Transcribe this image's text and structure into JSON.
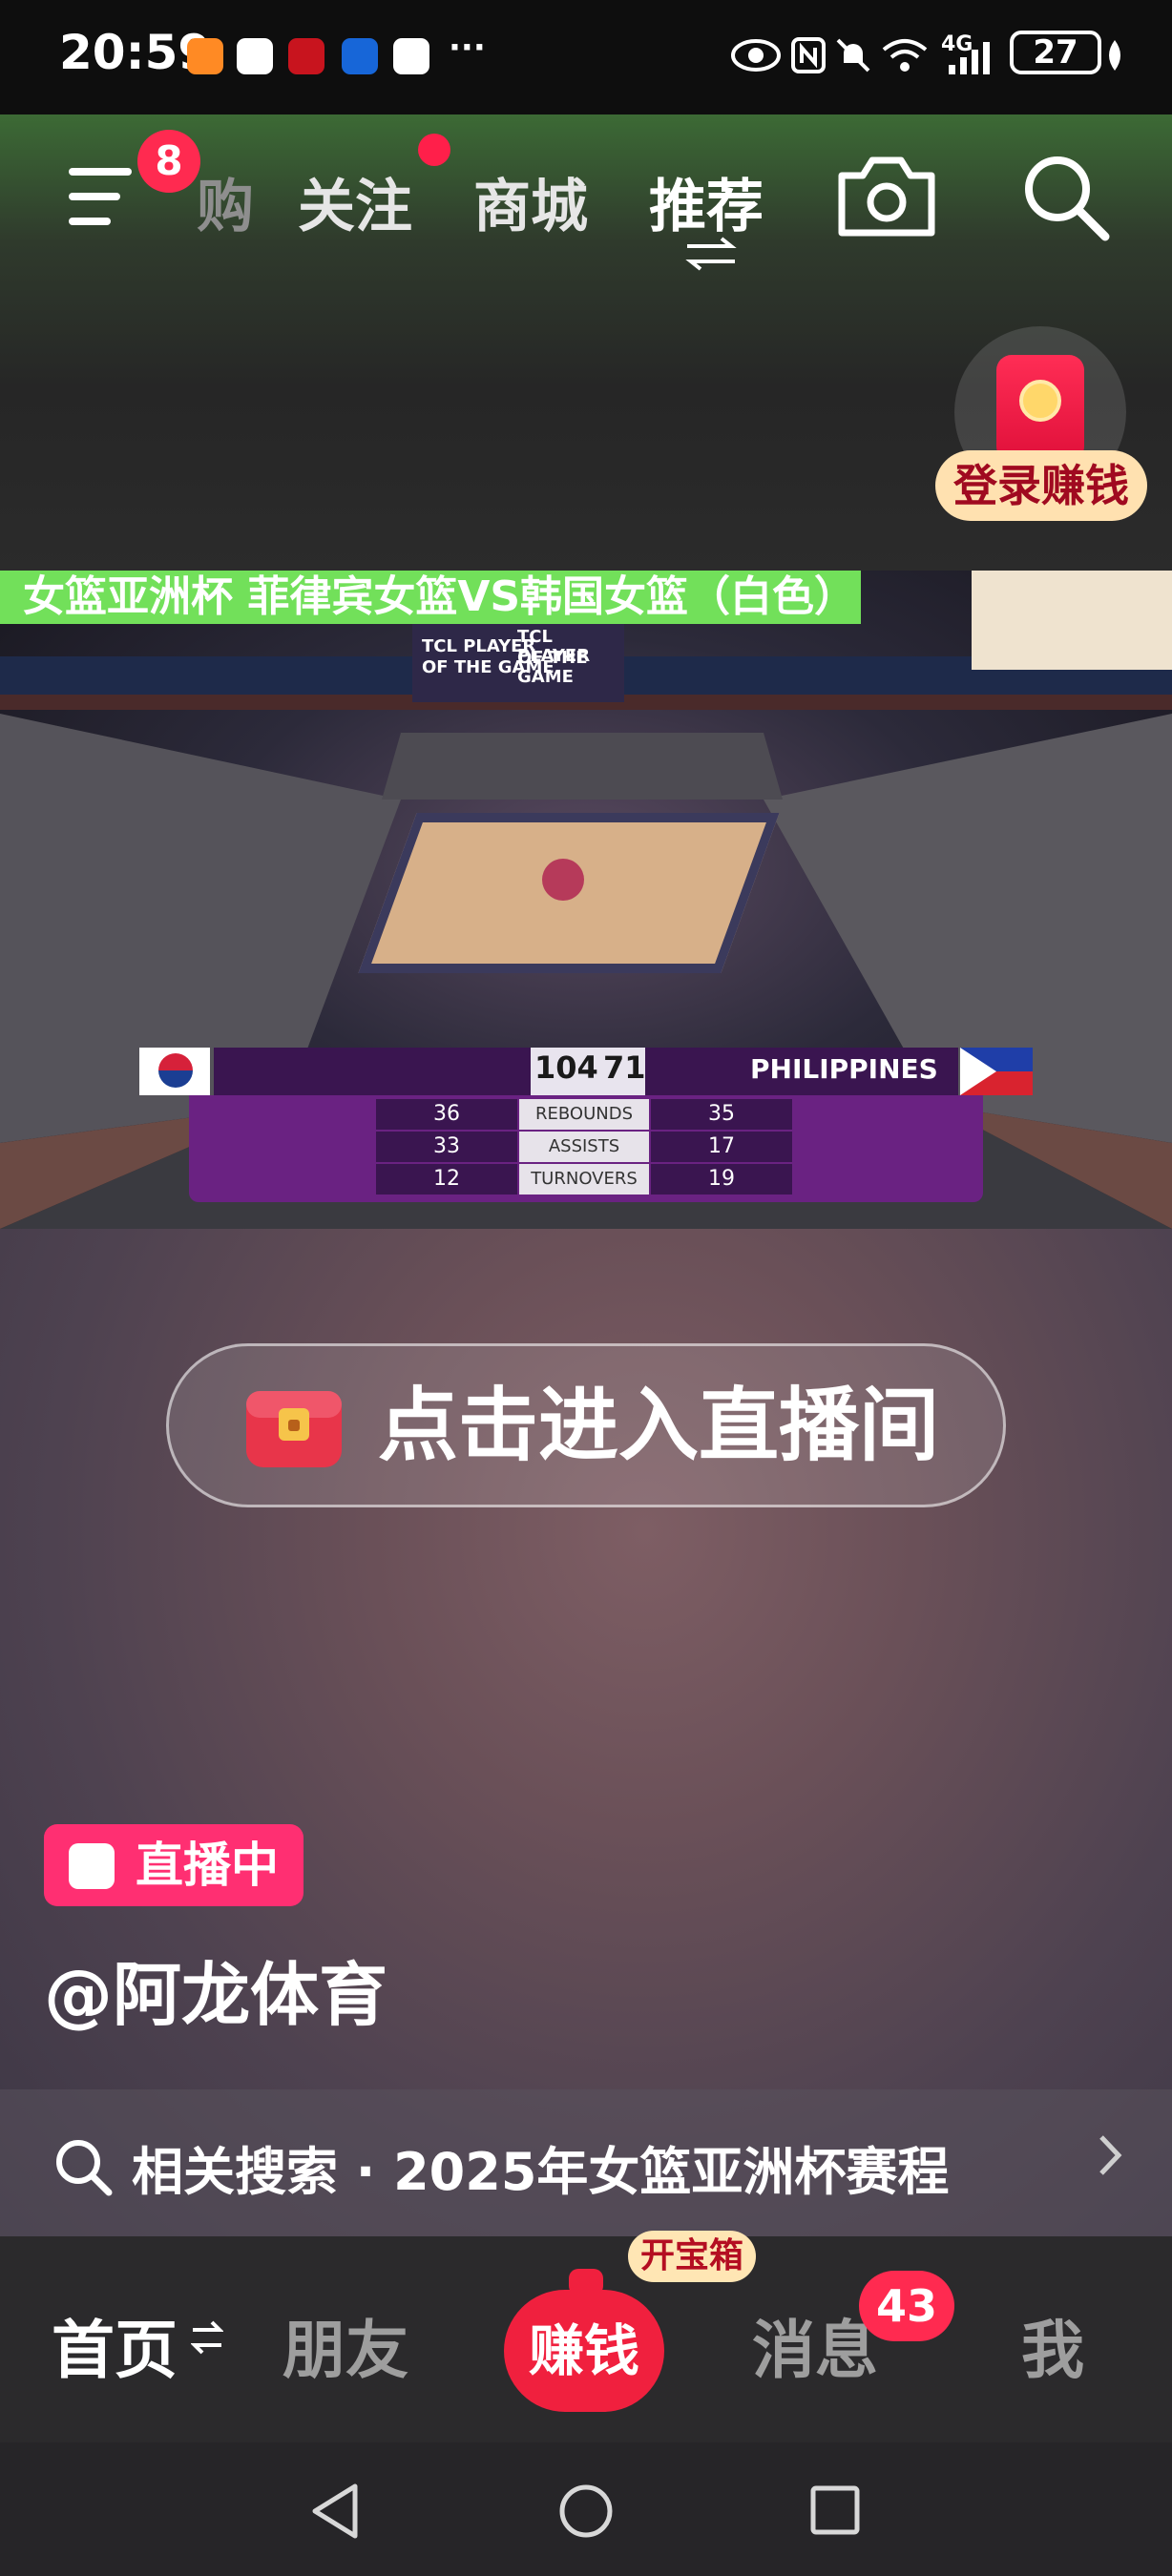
{
  "status_bar": {
    "time": "20:59",
    "more": "···",
    "network": "4G",
    "battery": "27"
  },
  "top_nav": {
    "tabs": [
      {
        "label": "购",
        "active": false
      },
      {
        "label": "关注",
        "active": false
      },
      {
        "label": "商城",
        "active": false
      },
      {
        "label": "推荐",
        "active": true
      }
    ],
    "menu_badge": "8",
    "icons": [
      "menu-icon",
      "camera-icon",
      "search-icon"
    ]
  },
  "red_packet": {
    "label": "登录赚钱"
  },
  "video": {
    "title": "女篮亚洲杯  菲律宾女篮VS韩国女篮（白色）",
    "sponsor_logo": "阿龙体育",
    "banner_text": [
      "TCL PLAYER",
      "OF THE GAME"
    ],
    "scoreboard": {
      "score_left": "104",
      "score_right": "71",
      "team_right": "PHILIPPINES",
      "stats": [
        {
          "left": "36",
          "label": "REBOUNDS",
          "right": "35"
        },
        {
          "left": "33",
          "label": "ASSISTS",
          "right": "17"
        },
        {
          "left": "12",
          "label": "TURNOVERS",
          "right": "19"
        }
      ]
    }
  },
  "enter_live": {
    "label": "点击进入直播间"
  },
  "live_badge": {
    "label": "直播中"
  },
  "streamer": {
    "name": "@阿龙体育"
  },
  "related_search": {
    "text": "相关搜索 · 2025年女篮亚洲杯赛程"
  },
  "bottom_nav": {
    "tabs": [
      {
        "label": "首页",
        "active": true
      },
      {
        "label": "朋友",
        "active": false
      },
      {
        "label": "赚钱",
        "active": false
      },
      {
        "label": "消息",
        "active": false
      },
      {
        "label": "我",
        "active": false
      }
    ],
    "chest_badge": "开宝箱",
    "message_badge": "43"
  },
  "colors": {
    "accent_red": "#ff2a50",
    "live_pink": "#ff2f72",
    "title_bar_green": "#72e05a",
    "earn_gold": "#ffe1b0"
  }
}
